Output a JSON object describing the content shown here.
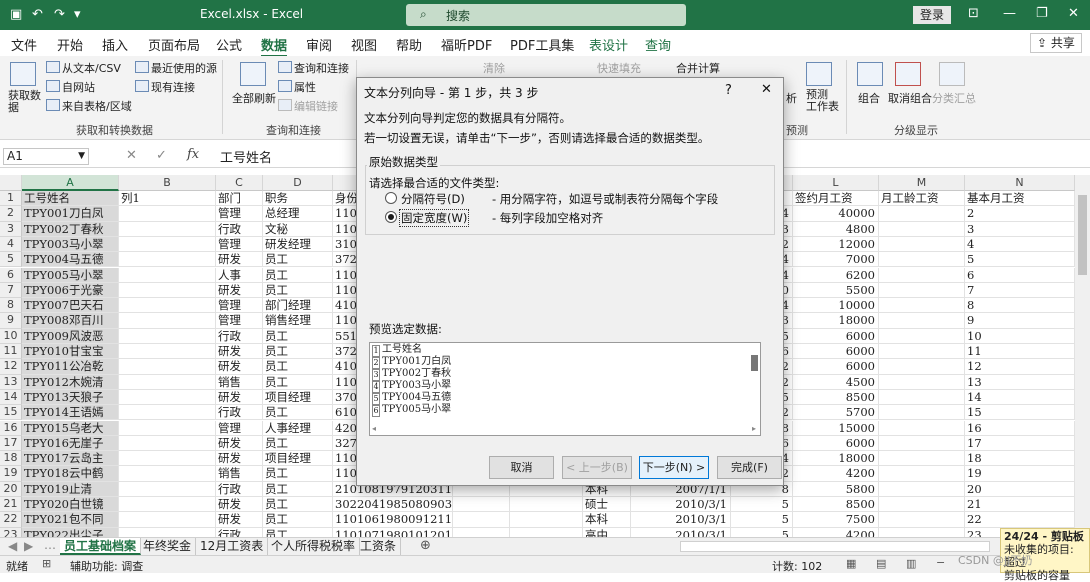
{
  "app": {
    "title": "Excel.xlsx  -  Excel",
    "search": "搜索",
    "login": "登录",
    "share": "共享"
  },
  "tabs": [
    "文件",
    "开始",
    "插入",
    "页面布局",
    "公式",
    "数据",
    "审阅",
    "视图",
    "帮助",
    "福昕PDF",
    "PDF工具集",
    "表设计",
    "查询"
  ],
  "ribbon": {
    "get_data": "获取数\n据",
    "from_text": "从文本/CSV",
    "from_web": "自网站",
    "from_table": "来自表格/区域",
    "recent": "最近使用的源",
    "existing": "现有连接",
    "group1": "获取和转换数据",
    "refresh_all": "全部刷新",
    "queries": "查询和连接",
    "props": "属性",
    "edit_links": "编辑链接",
    "group2": "查询和连接",
    "clear": "清除",
    "flash_fill": "快速填充",
    "consolidate": "合并计算",
    "analysis": "析",
    "forecast": "预测\n工作表",
    "group_forecast": "预测",
    "group_btn": "组合",
    "ungroup": "取消组合",
    "subtotal": "分类汇总",
    "group_outline": "分级显示"
  },
  "formula": {
    "cell": "A1",
    "content": "工号姓名"
  },
  "columns": [
    "A",
    "B",
    "C",
    "D",
    "L",
    "M",
    "N"
  ],
  "headers": {
    "A": "工号姓名",
    "B": "列1",
    "C": "部门",
    "D": "职务",
    "E": "身份",
    "L": "签约月工资",
    "M": "月工龄工资",
    "N": "基本月工资"
  },
  "rows": [
    {
      "n": "2",
      "a": "TPY001刀白凤",
      "c": "管理",
      "d": "总经理",
      "e": "1101",
      "k": "4",
      "l": "40000"
    },
    {
      "n": "3",
      "a": "TPY002丁春秋",
      "c": "行政",
      "d": "文秘",
      "e": "1101",
      "k": "3",
      "l": "4800"
    },
    {
      "n": "4",
      "a": "TPY003马小翠",
      "c": "管理",
      "d": "研发经理",
      "e": "3101",
      "k": "2",
      "l": "12000"
    },
    {
      "n": "5",
      "a": "TPY004马五德",
      "c": "研发",
      "d": "员工",
      "e": "3723",
      "k": "4",
      "l": "7000"
    },
    {
      "n": "6",
      "a": "TPY005马小翠",
      "c": "人事",
      "d": "员工",
      "e": "1101",
      "k": "4",
      "l": "6200"
    },
    {
      "n": "7",
      "a": "TPY006于光豪",
      "c": "研发",
      "d": "员工",
      "e": "1101",
      "k": "0",
      "l": "5500"
    },
    {
      "n": "8",
      "a": "TPY007巴天石",
      "c": "管理",
      "d": "部门经理",
      "e": "4102",
      "k": "4",
      "l": "10000"
    },
    {
      "n": "9",
      "a": "TPY008邓百川",
      "c": "管理",
      "d": "销售经理",
      "e": "1101",
      "k": "3",
      "l": "18000"
    },
    {
      "n": "10",
      "a": "TPY009风波恶",
      "c": "行政",
      "d": "员工",
      "e": "5510",
      "k": "5",
      "l": "6000"
    },
    {
      "n": "11",
      "a": "TPY010甘宝宝",
      "c": "研发",
      "d": "员工",
      "e": "3723",
      "k": "6",
      "l": "6000"
    },
    {
      "n": "12",
      "a": "TPY011公冶乾",
      "c": "研发",
      "d": "员工",
      "e": "4102",
      "k": "2",
      "l": "6000"
    },
    {
      "n": "13",
      "a": "TPY012木婉清",
      "c": "销售",
      "d": "员工",
      "e": "1101",
      "k": "2",
      "l": "4500"
    },
    {
      "n": "14",
      "a": "TPY013天狼子",
      "c": "研发",
      "d": "项目经理",
      "e": "3701",
      "k": "5",
      "l": "8500"
    },
    {
      "n": "15",
      "a": "TPY014王语嫣",
      "c": "行政",
      "d": "员工",
      "e": "6103",
      "k": "2",
      "l": "5700"
    },
    {
      "n": "16",
      "a": "TPY015乌老大",
      "c": "管理",
      "d": "人事经理",
      "e": "4203",
      "k": "8",
      "l": "15000"
    },
    {
      "n": "17",
      "a": "TPY016无崖子",
      "c": "研发",
      "d": "员工",
      "e": "3270",
      "k": "6",
      "l": "6000"
    },
    {
      "n": "18",
      "a": "TPY017云岛主",
      "c": "研发",
      "d": "项目经理",
      "e": "1101",
      "k": "4",
      "l": "18000"
    },
    {
      "n": "19",
      "a": "TPY018云中鹤",
      "c": "销售",
      "d": "员工",
      "e": "1101",
      "k": "2",
      "l": "4200"
    },
    {
      "n": "20",
      "a": "TPY019止清",
      "c": "行政",
      "d": "员工",
      "e": "210108197912031129",
      "h": "本科",
      "i": "2007/1/1",
      "k": "8",
      "l": "5800"
    },
    {
      "n": "21",
      "a": "TPY020白世镜",
      "c": "研发",
      "d": "员工",
      "e": "302204198508090312",
      "h": "硕士",
      "i": "2010/3/1",
      "k": "5",
      "l": "8500"
    },
    {
      "n": "22",
      "a": "TPY021包不同",
      "c": "研发",
      "d": "员工",
      "e": "110106198009121104",
      "h": "本科",
      "i": "2010/3/1",
      "k": "5",
      "l": "7500"
    },
    {
      "n": "23",
      "a": "TPY022出尘子",
      "c": "行政",
      "d": "员工",
      "e": "110107198010120109",
      "h": "高中",
      "i": "2010/3/1",
      "k": "5",
      "l": "4200"
    }
  ],
  "sheets": [
    "员工基础档案",
    "年终奖金",
    "12月工资表",
    "个人所得税税率",
    "工资条"
  ],
  "status": {
    "ready": "就绪",
    "access": "辅助功能: 调查",
    "count": "计数: 102"
  },
  "clipboard": {
    "title": "24/24 - 剪贴板",
    "line1": "未收集的项目: 超过",
    "line2": "剪贴板的容量"
  },
  "watermark": "CSDN @JJ不奶",
  "dialog": {
    "title": "文本分列向导 - 第 1 步，共 3 步",
    "help": "?",
    "close": "✕",
    "line1": "文本分列向导判定您的数据具有分隔符。",
    "line2": "若一切设置无误，请单击“下一步”，否则请选择最合适的数据类型。",
    "group": "原始数据类型",
    "choose": "请选择最合适的文件类型:",
    "opt1": "分隔符号(D)",
    "opt1_desc": "- 用分隔字符，如逗号或制表符分隔每个字段",
    "opt2": "固定宽度(W)",
    "opt2_desc": "- 每列字段加空格对齐",
    "preview_label": "预览选定数据:",
    "preview": [
      {
        "n": "1",
        "t": "工号姓名"
      },
      {
        "n": "2",
        "t": "TPY001刀白凤"
      },
      {
        "n": "3",
        "t": "TPY002丁春秋"
      },
      {
        "n": "4",
        "t": "TPY003马小翠"
      },
      {
        "n": "5",
        "t": "TPY004马五德"
      },
      {
        "n": "6",
        "t": "TPY005马小翠"
      }
    ],
    "cancel": "取消",
    "back": "< 上一步(B)",
    "next": "下一步(N) >",
    "finish": "完成(F)"
  }
}
